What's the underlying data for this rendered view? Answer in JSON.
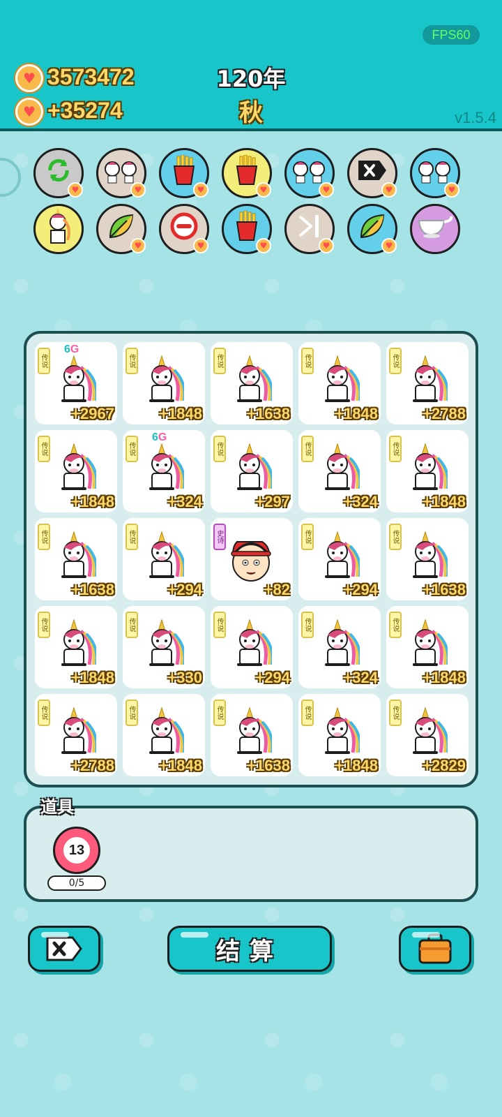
{
  "header": {
    "coins": "3573472",
    "income": "+35274",
    "year": "120年",
    "season": "秋",
    "fps": "FPS60",
    "version": "v1.5.4"
  },
  "skills_row1": [
    {
      "icon": "refresh-icon",
      "bg": "#c9c9c9"
    },
    {
      "icon": "double-unicorn-icon",
      "bg": "#e0d4c8"
    },
    {
      "icon": "fries-icon",
      "bg": "#63cfe8"
    },
    {
      "icon": "fries-icon",
      "bg": "#f3ee7a"
    },
    {
      "icon": "double-unicorn-icon",
      "bg": "#63cfe8"
    },
    {
      "icon": "delete-tag-icon",
      "bg": "#e0d4c8"
    },
    {
      "icon": "double-unicorn-icon",
      "bg": "#63cfe8"
    }
  ],
  "skills_row2": [
    {
      "icon": "unicorn-icon",
      "bg": "#f3ee7a"
    },
    {
      "icon": "leaf-icon",
      "bg": "#e0d4c8"
    },
    {
      "icon": "minus-circle-icon",
      "bg": "#e0d4c8"
    },
    {
      "icon": "fries-icon",
      "bg": "#63cfe8"
    },
    {
      "icon": "skip-icon",
      "bg": "#e0d4c8"
    },
    {
      "icon": "leaf-icon",
      "bg": "#63cfe8"
    },
    {
      "icon": "gravy-boat-icon",
      "bg": "#d59be0"
    }
  ],
  "board": {
    "tiles": [
      {
        "tag": "传说",
        "badge": "6G",
        "char": "unicorn",
        "value": "+2967"
      },
      {
        "tag": "传说",
        "badge": "",
        "char": "unicorn",
        "value": "+1848"
      },
      {
        "tag": "传说",
        "badge": "",
        "char": "unicorn",
        "value": "+1638"
      },
      {
        "tag": "传说",
        "badge": "",
        "char": "unicorn",
        "value": "+1848"
      },
      {
        "tag": "传说",
        "badge": "",
        "char": "unicorn",
        "value": "+2788"
      },
      {
        "tag": "传说",
        "badge": "",
        "char": "unicorn",
        "value": "+1848"
      },
      {
        "tag": "传说",
        "badge": "6G",
        "char": "unicorn",
        "value": "+324"
      },
      {
        "tag": "传说",
        "badge": "",
        "char": "unicorn",
        "value": "+297"
      },
      {
        "tag": "传说",
        "badge": "",
        "char": "unicorn",
        "value": "+324"
      },
      {
        "tag": "传说",
        "badge": "",
        "char": "unicorn",
        "value": "+1848"
      },
      {
        "tag": "传说",
        "badge": "",
        "char": "unicorn",
        "value": "+1638"
      },
      {
        "tag": "传说",
        "badge": "",
        "char": "unicorn",
        "value": "+294"
      },
      {
        "tag": "史诗",
        "badge": "",
        "char": "boy",
        "value": "+82"
      },
      {
        "tag": "传说",
        "badge": "",
        "char": "unicorn",
        "value": "+294"
      },
      {
        "tag": "传说",
        "badge": "",
        "char": "unicorn",
        "value": "+1638"
      },
      {
        "tag": "传说",
        "badge": "",
        "char": "unicorn",
        "value": "+1848"
      },
      {
        "tag": "传说",
        "badge": "",
        "char": "unicorn",
        "value": "+330"
      },
      {
        "tag": "传说",
        "badge": "",
        "char": "unicorn",
        "value": "+294"
      },
      {
        "tag": "传说",
        "badge": "",
        "char": "unicorn",
        "value": "+324"
      },
      {
        "tag": "传说",
        "badge": "",
        "char": "unicorn",
        "value": "+1848"
      },
      {
        "tag": "传说",
        "badge": "",
        "char": "unicorn",
        "value": "+2788"
      },
      {
        "tag": "传说",
        "badge": "",
        "char": "unicorn",
        "value": "+1848"
      },
      {
        "tag": "传说",
        "badge": "",
        "char": "unicorn",
        "value": "+1638"
      },
      {
        "tag": "传说",
        "badge": "",
        "char": "unicorn",
        "value": "+1848"
      },
      {
        "tag": "传说",
        "badge": "",
        "char": "unicorn",
        "value": "+2829"
      }
    ]
  },
  "items": {
    "title": "道具",
    "ball_value": "13",
    "count": "0/5"
  },
  "buttons": {
    "settle": "结算"
  }
}
